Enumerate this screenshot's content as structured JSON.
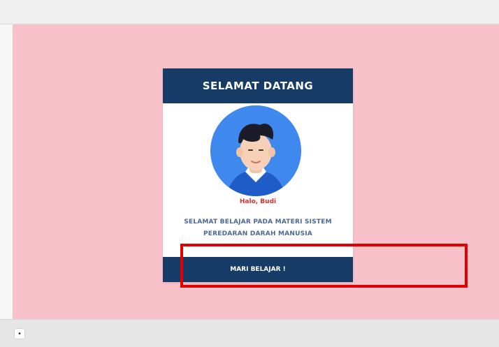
{
  "card": {
    "title": "SELAMAT DATANG",
    "greeting": "Halo, Budi",
    "message": "SELAMAT BELAJAR PADA MATERI SISTEM PEREDARAN DARAH MANUSIA",
    "button_label": "MARI BELAJAR !"
  },
  "controls": {
    "small_button_symbol": "•"
  },
  "colors": {
    "stage_background": "#f9c2ca",
    "card_header": "#173b67",
    "avatar_background": "#3f88ee",
    "greeting_text": "#d92d2d",
    "highlight_border": "#e10000"
  },
  "icons": {
    "avatar": "student-avatar-icon"
  }
}
